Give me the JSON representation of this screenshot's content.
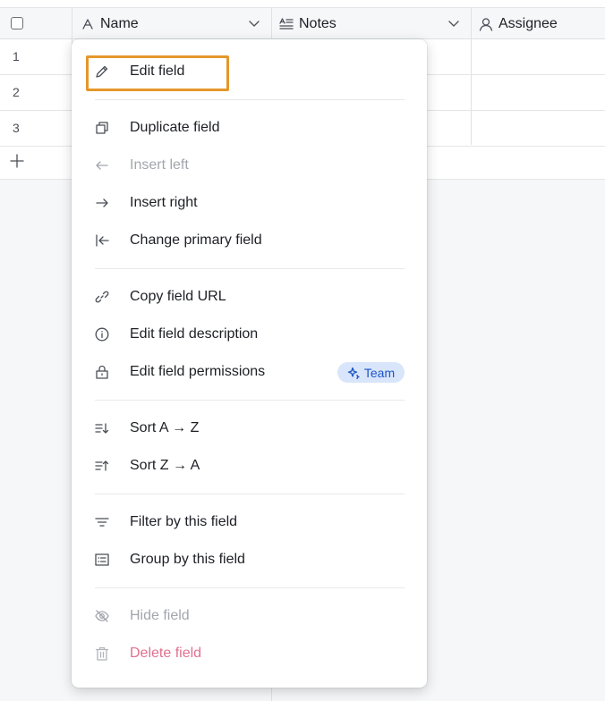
{
  "header": {
    "columns": [
      {
        "label": "Name",
        "icon": "text-a-icon"
      },
      {
        "label": "Notes",
        "icon": "long-text-icon"
      },
      {
        "label": "Assignee",
        "icon": "user-icon"
      }
    ]
  },
  "rows": [
    {
      "num": "1"
    },
    {
      "num": "2"
    },
    {
      "num": "3"
    }
  ],
  "menu": {
    "edit_field": "Edit field",
    "duplicate_field": "Duplicate field",
    "insert_left": "Insert left",
    "insert_right": "Insert right",
    "change_primary_field": "Change primary field",
    "copy_field_url": "Copy field URL",
    "edit_field_description": "Edit field description",
    "edit_field_permissions": "Edit field permissions",
    "team_badge": "Team",
    "sort_az": "Sort A → Z",
    "sort_za": "Sort Z → A",
    "filter_by_field": "Filter by this field",
    "group_by_field": "Group by this field",
    "hide_field": "Hide field",
    "delete_field": "Delete field"
  },
  "colors": {
    "highlight": "#e5972a",
    "badge_bg": "#d9e5fb",
    "badge_text": "#1c54c7",
    "danger": "#e0708f"
  }
}
